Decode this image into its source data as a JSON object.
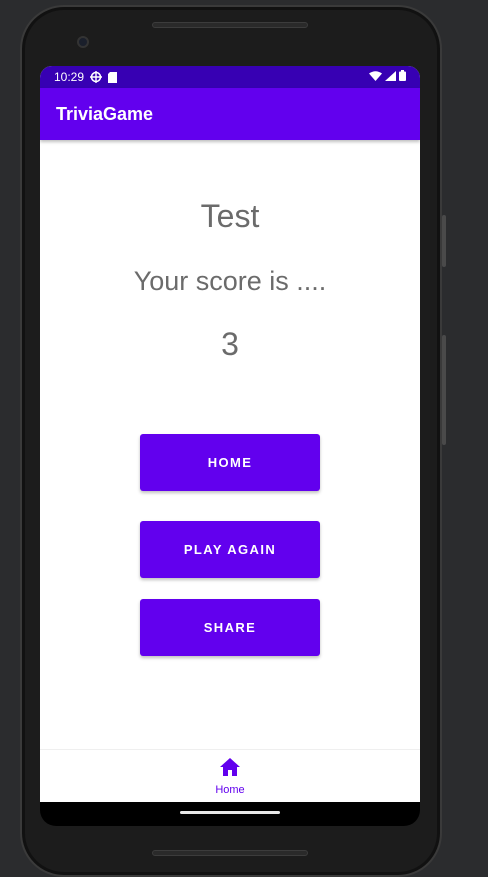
{
  "status_bar": {
    "time": "10:29"
  },
  "app_bar": {
    "title": "TriviaGame"
  },
  "content": {
    "title": "Test",
    "score_label": "Your score is ....",
    "score_value": "3"
  },
  "buttons": {
    "home": "HOME",
    "play_again": "PLAY AGAIN",
    "share": "SHARE"
  },
  "bottom_nav": {
    "items": [
      {
        "label": "Home",
        "icon": "home-icon",
        "selected": true
      }
    ]
  },
  "colors": {
    "primary": "#6200ee",
    "primary_dark": "#3700b3",
    "text_secondary": "#6b6b6b"
  }
}
